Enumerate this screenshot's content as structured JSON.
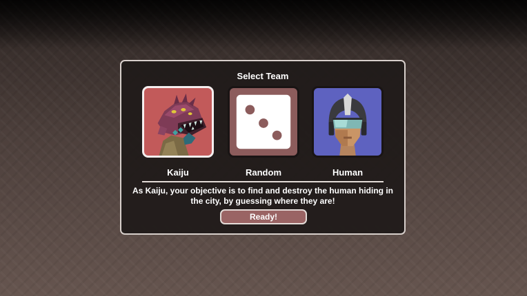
{
  "team_select": {
    "title": "Select Team",
    "options": [
      {
        "label": "Kaiju",
        "icon": "kaiju-portrait-icon",
        "color": "#c25a5a",
        "selected": true
      },
      {
        "label": "Random",
        "icon": "dice-icon",
        "color": "#8c5c5c",
        "selected": false
      },
      {
        "label": "Human",
        "icon": "human-helmet-portrait-icon",
        "color": "#5e62c0",
        "selected": false
      }
    ],
    "description": "As Kaiju, your objective is to find and destroy the human hiding in the city, by guessing where they are!",
    "ready_label": "Ready!"
  },
  "colors": {
    "panel_border": "#d8d0cc",
    "button": "#9a6464",
    "selected_border": "#f4eeee"
  }
}
